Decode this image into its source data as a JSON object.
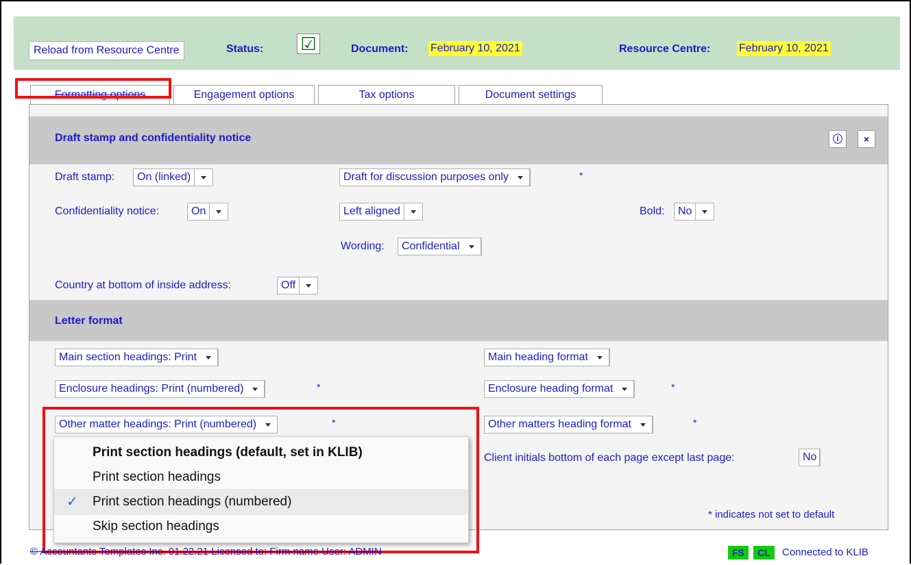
{
  "header": {
    "reload_button": "Reload from Resource Centre",
    "status_label": "Status:",
    "status_check": "☑",
    "document_label": "Document:",
    "document_date": "February 10, 2021",
    "resource_label": "Resource Centre:",
    "resource_date": "February 10, 2021"
  },
  "tabs": [
    "Formatting options",
    "Engagement options",
    "Tax options",
    "Document settings"
  ],
  "section1": {
    "title": "Draft stamp and confidentiality notice",
    "info_icon": "ⓘ",
    "close_icon": "×",
    "draft_stamp_label": "Draft stamp:",
    "draft_stamp_value": "On (linked)",
    "draft_text_value": "Draft for discussion purposes only",
    "asterisk": "*",
    "confidentiality_label": "Confidentiality notice:",
    "confidentiality_value": "On",
    "alignment_value": "Left aligned",
    "bold_label": "Bold:",
    "bold_value": "No",
    "wording_label": "Wording:",
    "wording_value": "Confidential",
    "country_label": "Country at bottom of inside address:",
    "country_value": "Off"
  },
  "section2": {
    "title": "Letter format",
    "main_headings": "Main section headings: Print",
    "enclosure_headings": "Enclosure headings: Print (numbered)",
    "other_headings": "Other matter headings: Print (numbered)",
    "main_format": "Main heading format",
    "enclosure_format": "Enclosure heading format",
    "other_format": "Other matters heading format",
    "initials_label": "Client initials bottom of each page except last page:",
    "initials_value": "No",
    "asterisk": "*",
    "note": "* indicates not set to default"
  },
  "menu": {
    "items": [
      "Print section headings (default, set in KLIB)",
      "Print section headings",
      "Print section headings (numbered)",
      "Skip section headings"
    ],
    "checkmark": "✓"
  },
  "footer": {
    "copyright": "© Accountants Templates Inc.  01.22.21   Licensed to: Firm name   User: ADMIN",
    "badge_fs": "FS",
    "badge_cl": "CL",
    "connection": "Connected to KLIB"
  }
}
